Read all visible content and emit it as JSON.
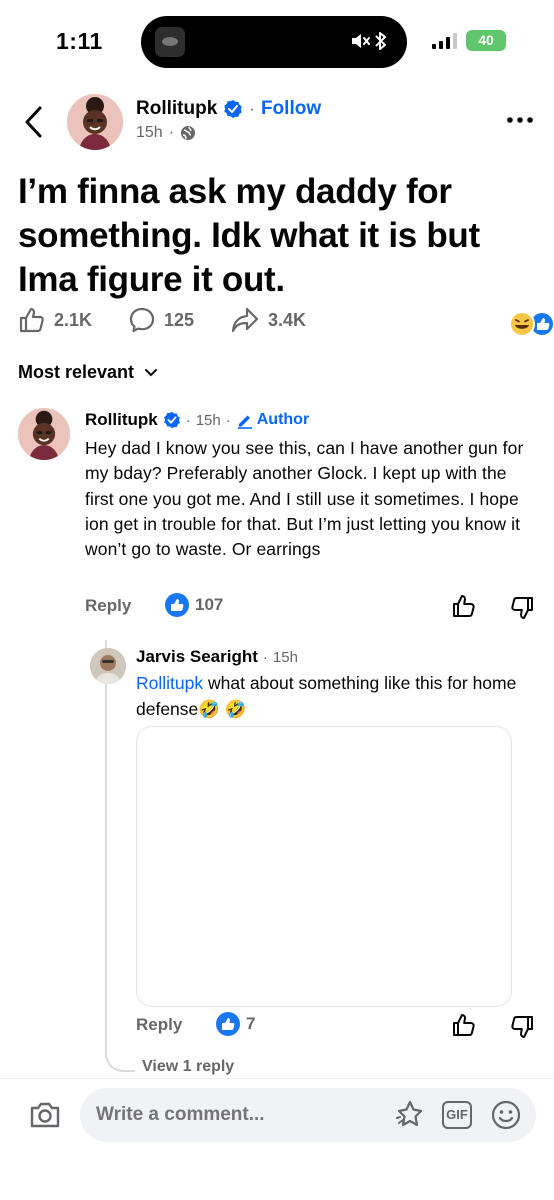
{
  "status_bar": {
    "time": "1:11",
    "battery": "40"
  },
  "post": {
    "author": "Rollitupk",
    "follow_label": "Follow",
    "dot": "·",
    "time": "15h",
    "text": "I’m finna ask my daddy for something. Idk what it is but Ima figure it out.",
    "likes": "2.1K",
    "comments": "125",
    "shares": "3.4K"
  },
  "sort": {
    "label": "Most relevant"
  },
  "comments": [
    {
      "author": "Rollitupk",
      "dot": "·",
      "time": "15h",
      "badge": "Author",
      "text": "Hey dad I know you see this, can I have another gun for my bday? Preferably another Glock. I kept up with the first one you got me. And I still use it sometimes. I hope ion get in trouble for that. But I’m just letting you know it won’t go to waste. Or earrings",
      "reply_label": "Reply",
      "likes": "107"
    },
    {
      "author": "Jarvis Searight",
      "dot": "·",
      "time": "15h",
      "mention": "Rollitupk",
      "text": " what about something like this for home defense🤣 🤣",
      "reply_label": "Reply",
      "likes": "7",
      "view_replies": "View 1 reply"
    }
  ],
  "composer": {
    "placeholder": "Write a comment...",
    "gif_label": "GIF"
  },
  "colors": {
    "accent": "#0866ff",
    "like_blue": "#1877f2",
    "secondary_text": "#65676b"
  }
}
